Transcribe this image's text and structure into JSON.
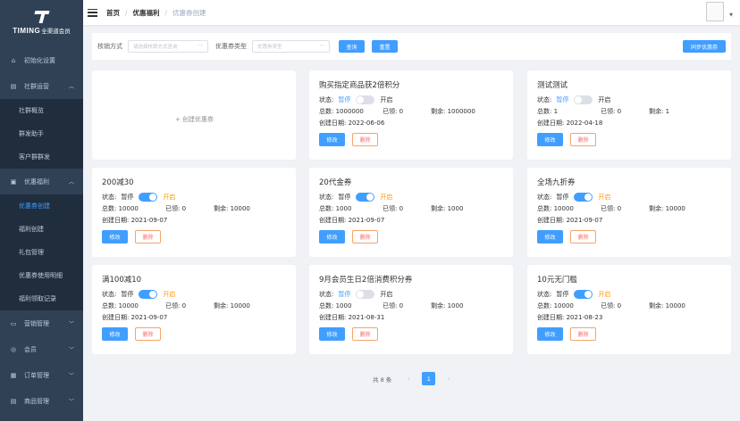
{
  "brand": {
    "name": "TIMING",
    "subtitle": "全渠道会员"
  },
  "sidebar": {
    "items": [
      {
        "label": "初始化设置",
        "icon": "home-icon"
      },
      {
        "label": "社群运营",
        "icon": "document-icon",
        "expanded": true,
        "children": [
          "社群概览",
          "群发助手",
          "客户群群发"
        ]
      },
      {
        "label": "优惠福利",
        "icon": "window-icon",
        "expanded": true,
        "children": [
          "优惠券创建",
          "福利创建",
          "礼包管理",
          "优惠券使用明细",
          "福利领取记录"
        ],
        "active_child": "优惠券创建"
      },
      {
        "label": "营销管理",
        "icon": "monitor-icon"
      },
      {
        "label": "会员",
        "icon": "dollar-icon"
      },
      {
        "label": "订单管理",
        "icon": "order-icon"
      },
      {
        "label": "商品管理",
        "icon": "document-icon"
      }
    ]
  },
  "header": {
    "breadcrumb": [
      "首页",
      "优惠福利",
      "优惠券创建"
    ]
  },
  "filter": {
    "writeoff_label": "核销方式",
    "writeoff_placeholder": "请选择核销方式查询",
    "type_label": "优惠券类型",
    "type_placeholder": "优惠券类型",
    "query_button": "查询",
    "reset_button": "重置",
    "sync_button": "同步优惠券"
  },
  "create_card": {
    "label": "+ 创建优惠券"
  },
  "labels": {
    "status": "状态:",
    "paused": "暂停",
    "enabled": "开启",
    "total": "总数:",
    "used": "已领:",
    "remaining": "剩余:",
    "created": "创建日期:",
    "edit": "修改",
    "delete": "删除"
  },
  "coupons": [
    {
      "title": "购买指定商品获2倍积分",
      "enabled": false,
      "total": "1000000",
      "used": "0",
      "remaining": "1000000",
      "created": "2022-06-06"
    },
    {
      "title": "测试测试",
      "enabled": false,
      "total": "1",
      "used": "0",
      "remaining": "1",
      "created": "2022-04-18"
    },
    {
      "title": "200减30",
      "enabled": true,
      "total": "10000",
      "used": "0",
      "remaining": "10000",
      "created": "2021-09-07"
    },
    {
      "title": "20代金券",
      "enabled": true,
      "total": "1000",
      "used": "0",
      "remaining": "1000",
      "created": "2021-09-07"
    },
    {
      "title": "全场九折券",
      "enabled": true,
      "total": "10000",
      "used": "0",
      "remaining": "10000",
      "created": "2021-09-07"
    },
    {
      "title": "满100减10",
      "enabled": true,
      "total": "10000",
      "used": "0",
      "remaining": "10000",
      "created": "2021-09-07"
    },
    {
      "title": "9月会员生日2倍消费积分券",
      "enabled": false,
      "total": "1000",
      "used": "0",
      "remaining": "1000",
      "created": "2021-08-31"
    },
    {
      "title": "10元无门槛",
      "enabled": true,
      "total": "10000",
      "used": "0",
      "remaining": "10000",
      "created": "2021-08-23"
    }
  ],
  "pagination": {
    "total_text": "共 8 条",
    "current": "1",
    "prev": "‹",
    "next": "›"
  },
  "colors": {
    "primary": "#409eff",
    "sidebar": "#304156",
    "active_text": "#ff9900",
    "danger_border": "#f5a46a"
  }
}
